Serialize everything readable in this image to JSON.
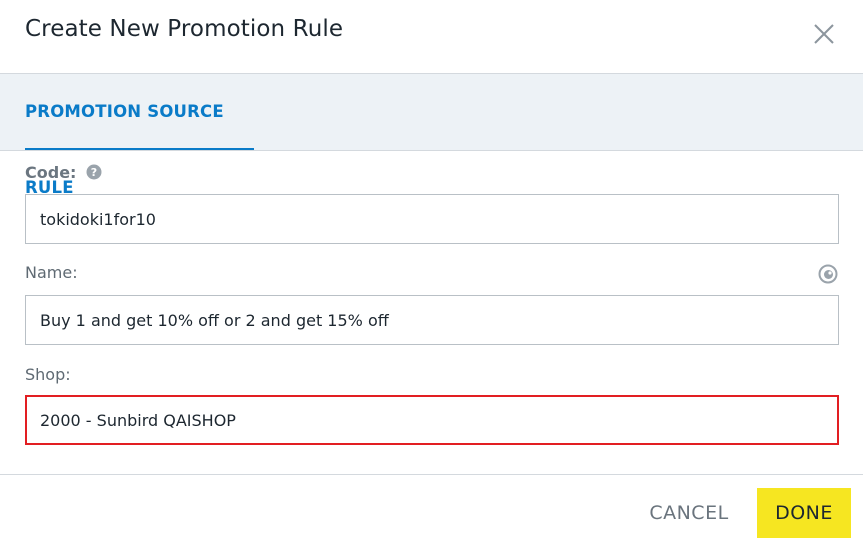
{
  "dialog": {
    "title": "Create New Promotion Rule"
  },
  "tabs": [
    {
      "label": "PROMOTION SOURCE RULE",
      "active": true
    }
  ],
  "form": {
    "code": {
      "label": "Code:",
      "value": "tokidoki1for10"
    },
    "name": {
      "label": "Name:",
      "value": "Buy 1 and get 10% off or 2 and get 15% off"
    },
    "shop": {
      "label": "Shop:",
      "value": "2000 - Sunbird QAISHOP",
      "state": "error"
    }
  },
  "footer": {
    "cancel_label": "CANCEL",
    "done_label": "DONE"
  },
  "icons": {
    "close": "close-icon",
    "help": "help-circle-icon",
    "localization": "globe-icon"
  },
  "colors": {
    "accent": "#0a7bc8",
    "done_button": "#f6e621",
    "error_border": "#e21e22",
    "tab_background": "#edf2f6"
  }
}
